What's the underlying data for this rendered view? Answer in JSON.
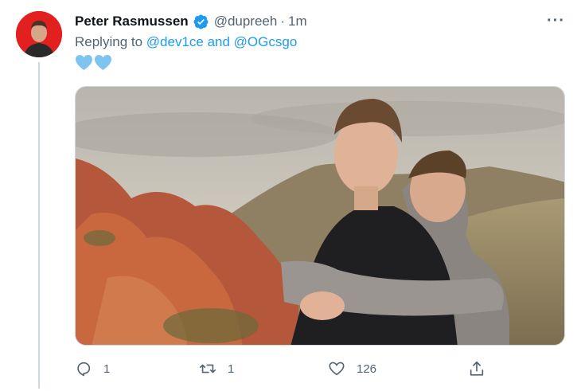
{
  "tweet": {
    "author_name": "Peter Rasmussen",
    "author_handle": "@dupreeh",
    "separator": "·",
    "timestamp": "1m",
    "replying_prefix": "Replying to ",
    "mention_1": "@dev1ce",
    "mention_joiner": " and ",
    "mention_2": "@OGcsgo",
    "emoji": [
      "blue-heart",
      "blue-heart"
    ],
    "more_label": "···"
  },
  "actions": {
    "reply_count": "1",
    "retweet_count": "1",
    "like_count": "126"
  },
  "icons": {
    "verified": "verified-badge-icon",
    "reply": "reply-icon",
    "retweet": "retweet-icon",
    "like": "heart-icon",
    "share": "share-icon"
  },
  "colors": {
    "accent": "#1d9bf0",
    "secondary_text": "#536471",
    "avatar_bg": "#e1201f",
    "heart_emoji": "#7fc4ef"
  }
}
